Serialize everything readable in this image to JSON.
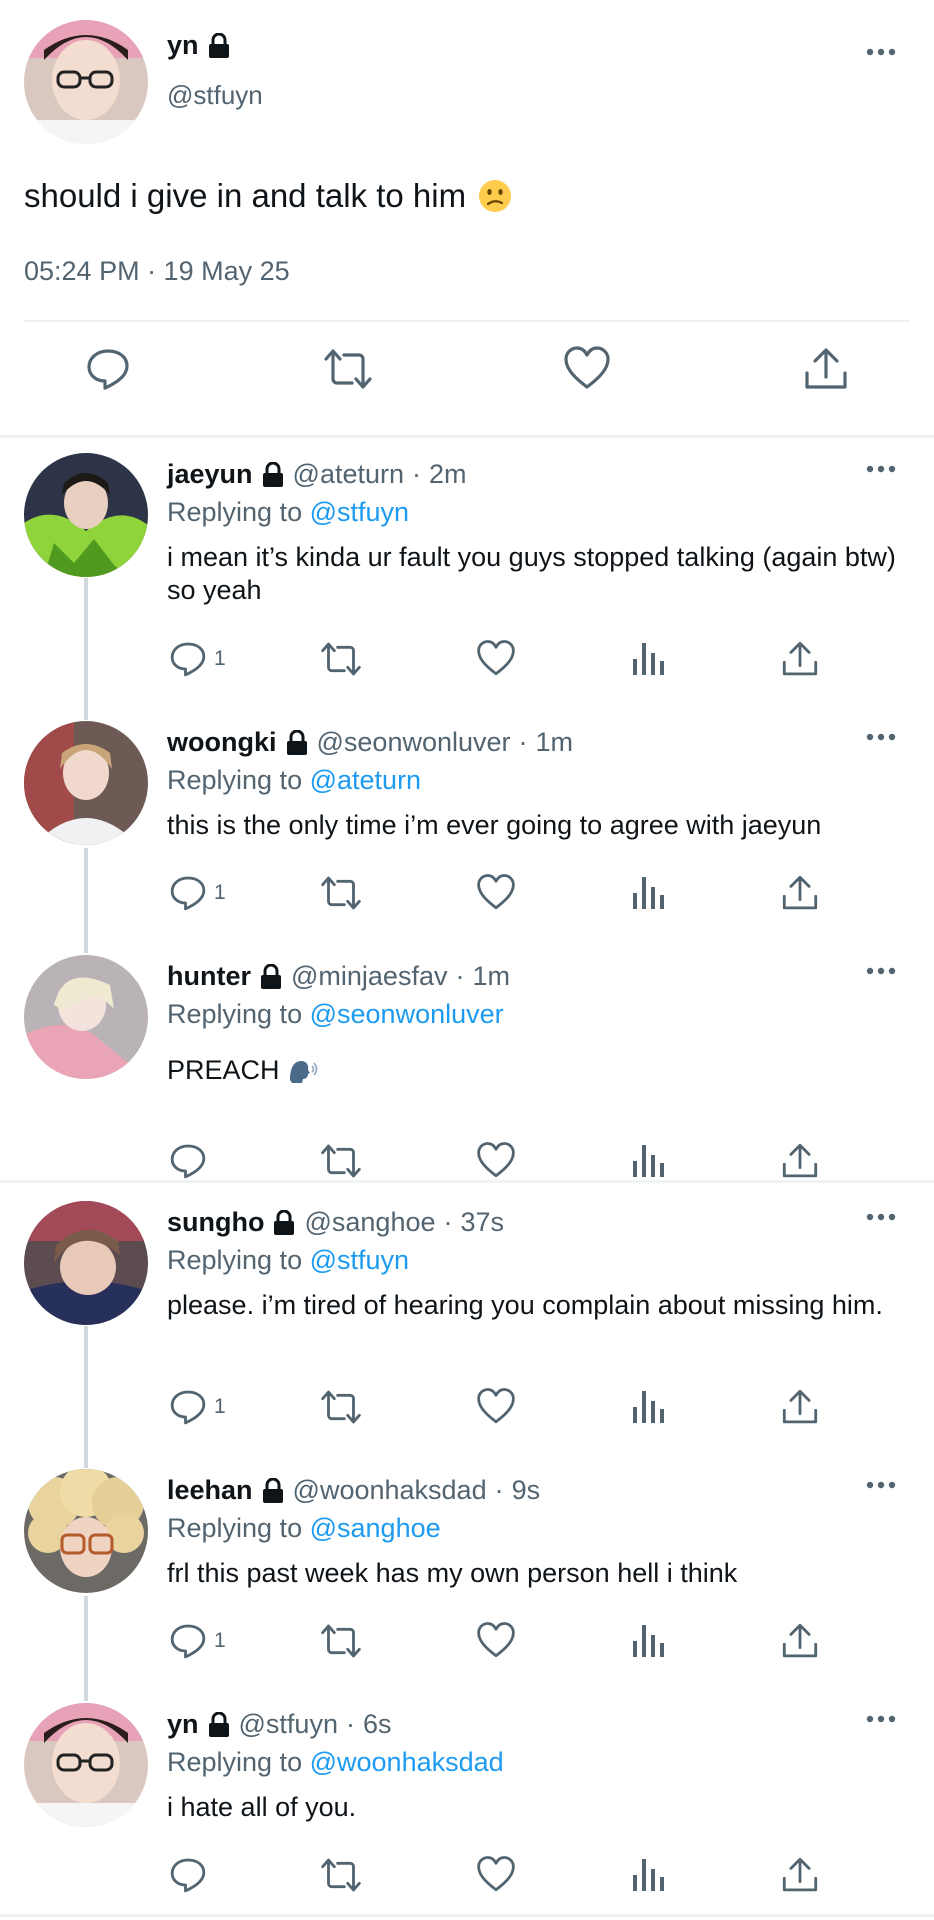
{
  "main_tweet": {
    "name": "yn",
    "handle": "@stfuyn",
    "text": "should i give in and talk to him",
    "timestamp": "05:24 PM · 19 May 25",
    "icons": [
      "more-icon",
      "lock-icon",
      "confused-face-emoji",
      "reply-icon",
      "retweet-icon",
      "like-icon",
      "share-icon"
    ]
  },
  "replies": [
    {
      "name": "jaeyun",
      "handle": "@ateturn",
      "age": "2m",
      "replying_prefix": "Replying to",
      "replying_to": "@stfuyn",
      "text": "i mean it’s kinda ur fault you guys stopped talking (again btw) so yeah",
      "reply_count": "1"
    },
    {
      "name": "woongki",
      "handle": "@seonwonluver",
      "age": "1m",
      "replying_prefix": "Replying to",
      "replying_to": "@ateturn",
      "text": "this is the only time i’m ever going to agree with jaeyun",
      "reply_count": "1"
    },
    {
      "name": "hunter",
      "handle": "@minjaesfav",
      "age": "1m",
      "replying_prefix": "Replying to",
      "replying_to": "@seonwonluver",
      "text": "PREACH",
      "reply_count": ""
    },
    {
      "name": "sungho",
      "handle": "@sanghoe",
      "age": "37s",
      "replying_prefix": "Replying to",
      "replying_to": "@stfuyn",
      "text": "please. i’m tired of hearing you complain about missing him.",
      "reply_count": "1"
    },
    {
      "name": "leehan",
      "handle": "@woonhaksdad",
      "age": "9s",
      "replying_prefix": "Replying to",
      "replying_to": "@sanghoe",
      "text": "frl this past week has my own person hell i think",
      "reply_count": "1"
    },
    {
      "name": "yn",
      "handle": "@stfuyn",
      "age": "6s",
      "replying_prefix": "Replying to",
      "replying_to": "@woonhaksdad",
      "text": "i hate all of you.",
      "reply_count": ""
    }
  ],
  "colors": {
    "text": "#0f1419",
    "secondary": "#536471",
    "link": "#1d9bf0",
    "divider": "#eff3f4",
    "thread_line": "#cfd9de"
  }
}
